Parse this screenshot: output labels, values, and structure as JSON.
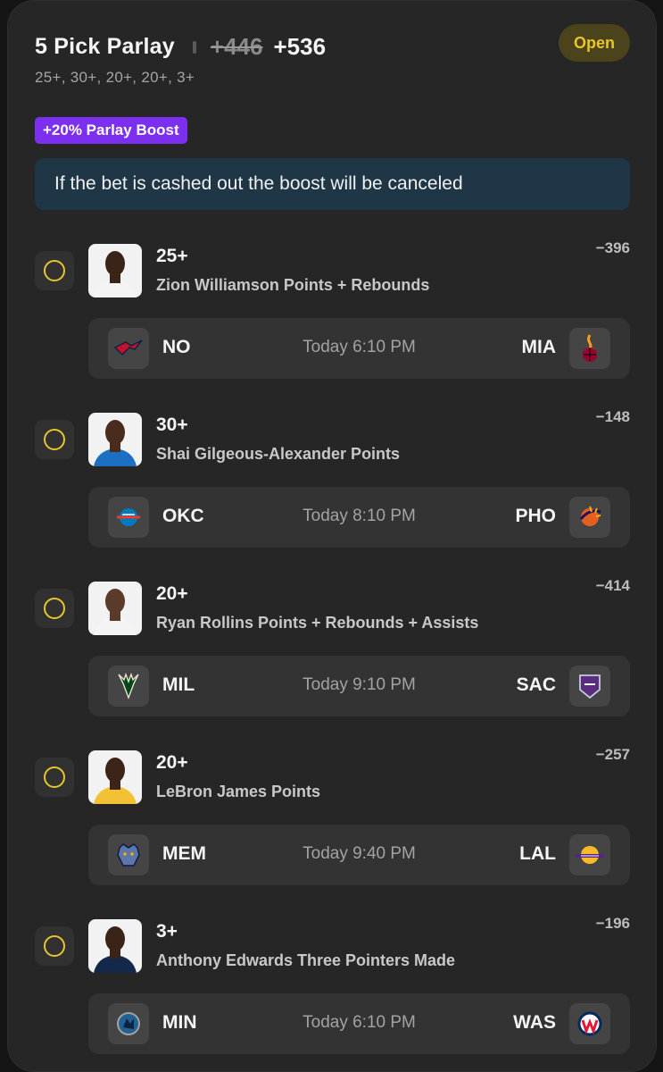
{
  "header": {
    "title": "5 Pick Parlay",
    "old_odds": "+446",
    "new_odds": "+536",
    "subtitle": "25+, 30+, 20+, 20+, 3+",
    "status": "Open"
  },
  "boost": {
    "label": "+20% Parlay Boost",
    "notice": "If the bet is cashed out the boost will be canceled"
  },
  "picks": [
    {
      "line": "25+",
      "market": "Zion Williamson Points + Rebounds",
      "odds": "−396",
      "jersey_color": "#f4f4f4",
      "skin": "#3a2418",
      "game": {
        "home": "NO",
        "time": "Today 6:10 PM",
        "away": "MIA",
        "home_icon": "pelicans-logo-icon",
        "away_icon": "heat-logo-icon"
      }
    },
    {
      "line": "30+",
      "market": "Shai Gilgeous-Alexander Points",
      "odds": "−148",
      "jersey_color": "#1d6fc4",
      "skin": "#4a2c1d",
      "game": {
        "home": "OKC",
        "time": "Today 8:10 PM",
        "away": "PHO",
        "home_icon": "thunder-logo-icon",
        "away_icon": "suns-logo-icon"
      }
    },
    {
      "line": "20+",
      "market": "Ryan Rollins Points + Rebounds + Assists",
      "odds": "−414",
      "jersey_color": "#f4f4f4",
      "skin": "#5a3a28",
      "game": {
        "home": "MIL",
        "time": "Today 9:10 PM",
        "away": "SAC",
        "home_icon": "bucks-logo-icon",
        "away_icon": "kings-logo-icon"
      }
    },
    {
      "line": "20+",
      "market": "LeBron James Points",
      "odds": "−257",
      "jersey_color": "#f3c234",
      "skin": "#3d2418",
      "game": {
        "home": "MEM",
        "time": "Today 9:40 PM",
        "away": "LAL",
        "home_icon": "grizzlies-logo-icon",
        "away_icon": "lakers-logo-icon"
      }
    },
    {
      "line": "3+",
      "market": "Anthony Edwards Three Pointers Made",
      "odds": "−196",
      "jersey_color": "#14294a",
      "skin": "#3a2418",
      "game": {
        "home": "MIN",
        "time": "Today 6:10 PM",
        "away": "WAS",
        "home_icon": "timberwolves-logo-icon",
        "away_icon": "wizards-logo-icon"
      }
    }
  ]
}
